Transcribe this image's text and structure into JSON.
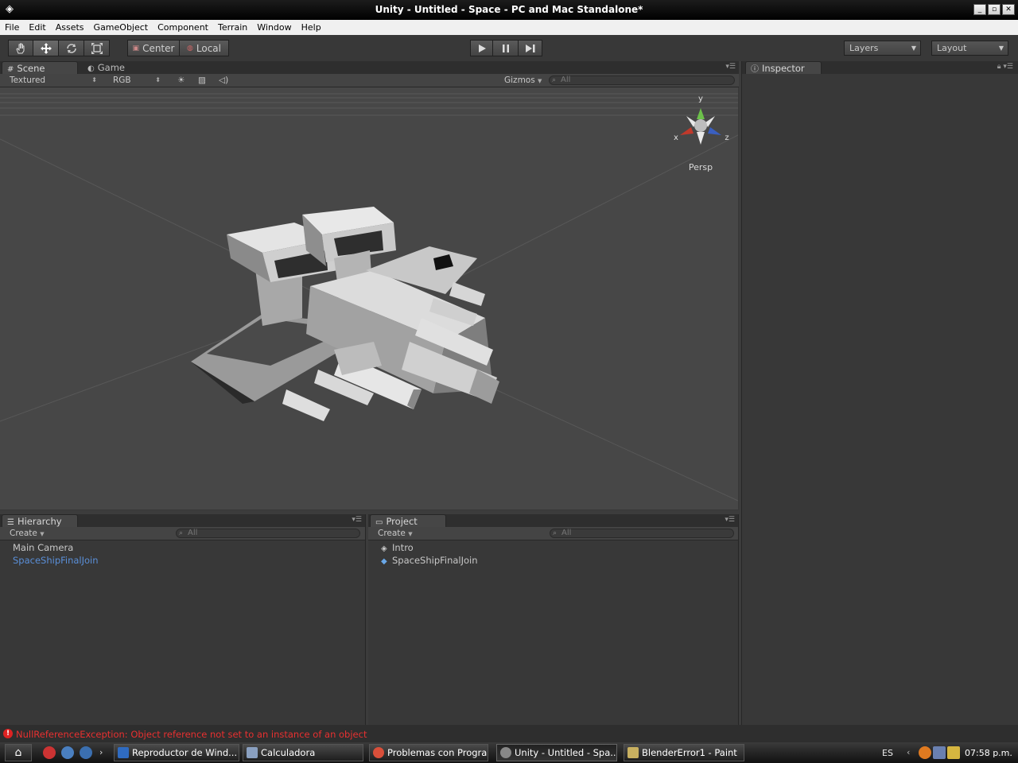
{
  "window": {
    "title": "Unity - Untitled - Space - PC and Mac Standalone*",
    "minimize": "_",
    "maximize": "▫",
    "close": "✕"
  },
  "menubar": [
    "File",
    "Edit",
    "Assets",
    "GameObject",
    "Component",
    "Terrain",
    "Window",
    "Help"
  ],
  "toolbar": {
    "pivot": "Center",
    "space": "Local",
    "layers": "Layers",
    "layout": "Layout"
  },
  "scene": {
    "tab_scene": "Scene",
    "tab_game": "Game",
    "render_mode": "Textured",
    "color_mode": "RGB",
    "gizmos": "Gizmos",
    "search_placeholder": "All",
    "gizmo_y": "y",
    "gizmo_x": "x",
    "gizmo_z": "z",
    "projection": "Persp"
  },
  "inspector": {
    "tab": "Inspector"
  },
  "hierarchy": {
    "tab": "Hierarchy",
    "create": "Create",
    "search_placeholder": "All",
    "items": [
      "Main Camera",
      "SpaceShipFinalJoin"
    ]
  },
  "project": {
    "tab": "Project",
    "create": "Create",
    "search_placeholder": "All",
    "items": [
      "Intro",
      "SpaceShipFinalJoin"
    ]
  },
  "status": {
    "message": "NullReferenceException: Object reference not set to an instance of an object"
  },
  "taskbar": {
    "tasks": [
      "Reproductor de Wind...",
      "Calculadora",
      "Problemas con Progra...",
      "Unity - Untitled - Spa...",
      "BlenderError1 - Paint"
    ],
    "language": "ES",
    "clock": "07:58 p.m."
  },
  "colors": {
    "scene_bg": "#474747",
    "panel_bg": "#383838",
    "error_red": "#e83030",
    "link_blue": "#5a8fd8"
  }
}
